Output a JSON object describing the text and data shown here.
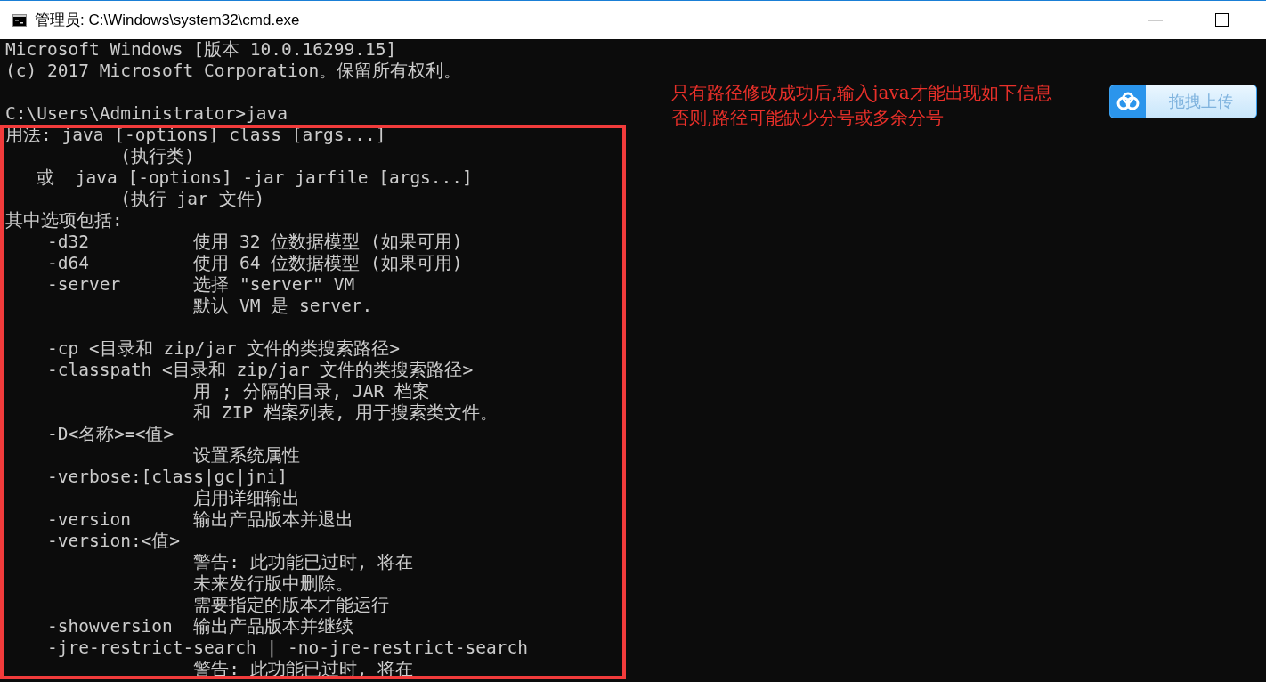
{
  "window": {
    "title": "管理员: C:\\Windows\\system32\\cmd.exe"
  },
  "console": {
    "lines": [
      {
        "text": "Microsoft Windows [版本 10.0.16299.15]"
      },
      {
        "text": "(c) 2017 Microsoft Corporation。保留所有权利。"
      },
      {
        "text": "C:\\Users\\Administrator>java",
        "gap_before": true
      },
      {
        "text": "用法: java [-options] class [args...]"
      },
      {
        "text": "           (执行类)"
      },
      {
        "text": "   或  java [-options] -jar jarfile [args...]"
      },
      {
        "text": "           (执行 jar 文件)"
      },
      {
        "text": "其中选项包括:"
      },
      {
        "text": "    -d32          使用 32 位数据模型 (如果可用)"
      },
      {
        "text": "    -d64          使用 64 位数据模型 (如果可用)"
      },
      {
        "text": "    -server       选择 \"server\" VM"
      },
      {
        "text": "                  默认 VM 是 server."
      },
      {
        "text": "    -cp <目录和 zip/jar 文件的类搜索路径>",
        "gap_before": true
      },
      {
        "text": "    -classpath <目录和 zip/jar 文件的类搜索路径>"
      },
      {
        "text": "                  用 ; 分隔的目录, JAR 档案"
      },
      {
        "text": "                  和 ZIP 档案列表, 用于搜索类文件。"
      },
      {
        "text": "    -D<名称>=<值>"
      },
      {
        "text": "                  设置系统属性"
      },
      {
        "text": "    -verbose:[class|gc|jni]"
      },
      {
        "text": "                  启用详细输出"
      },
      {
        "text": "    -version      输出产品版本并退出"
      },
      {
        "text": "    -version:<值>"
      },
      {
        "text": "                  警告: 此功能已过时, 将在"
      },
      {
        "text": "                  未来发行版中删除。"
      },
      {
        "text": "                  需要指定的版本才能运行"
      },
      {
        "text": "    -showversion  输出产品版本并继续"
      },
      {
        "text": "    -jre-restrict-search | -no-jre-restrict-search"
      },
      {
        "text": "                  警告: 此功能已过时, 将在"
      }
    ]
  },
  "annotation": {
    "lines": [
      "只有路径修改成功后,输入java才能出现如下信息",
      "否则,路径可能缺少分号或多余分号"
    ]
  },
  "upload_button": {
    "label": "拖拽上传"
  }
}
